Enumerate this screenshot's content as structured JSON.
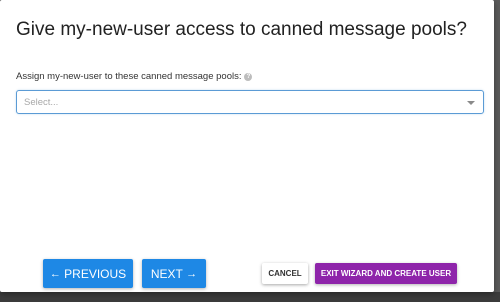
{
  "dialog": {
    "title": "Give my-new-user access to canned message pools?"
  },
  "form": {
    "field_label": "Assign my-new-user to these canned message pools:",
    "help_icon_glyph": "?",
    "select_placeholder": "Select..."
  },
  "buttons": {
    "previous_arrow": "←",
    "previous_label": "PREVIOUS",
    "next_label": "NEXT",
    "next_arrow": "→",
    "cancel_label": "CANCEL",
    "exit_label": "EXIT WIZARD AND CREATE USER"
  },
  "colors": {
    "primary_blue": "#1e88e5",
    "exit_purple": "#8e24aa",
    "select_border": "#5b9bd5"
  },
  "icons": {
    "help": "help-icon",
    "dropdown": "chevron-down-icon",
    "previous": "arrow-left-icon",
    "next": "arrow-right-icon"
  }
}
